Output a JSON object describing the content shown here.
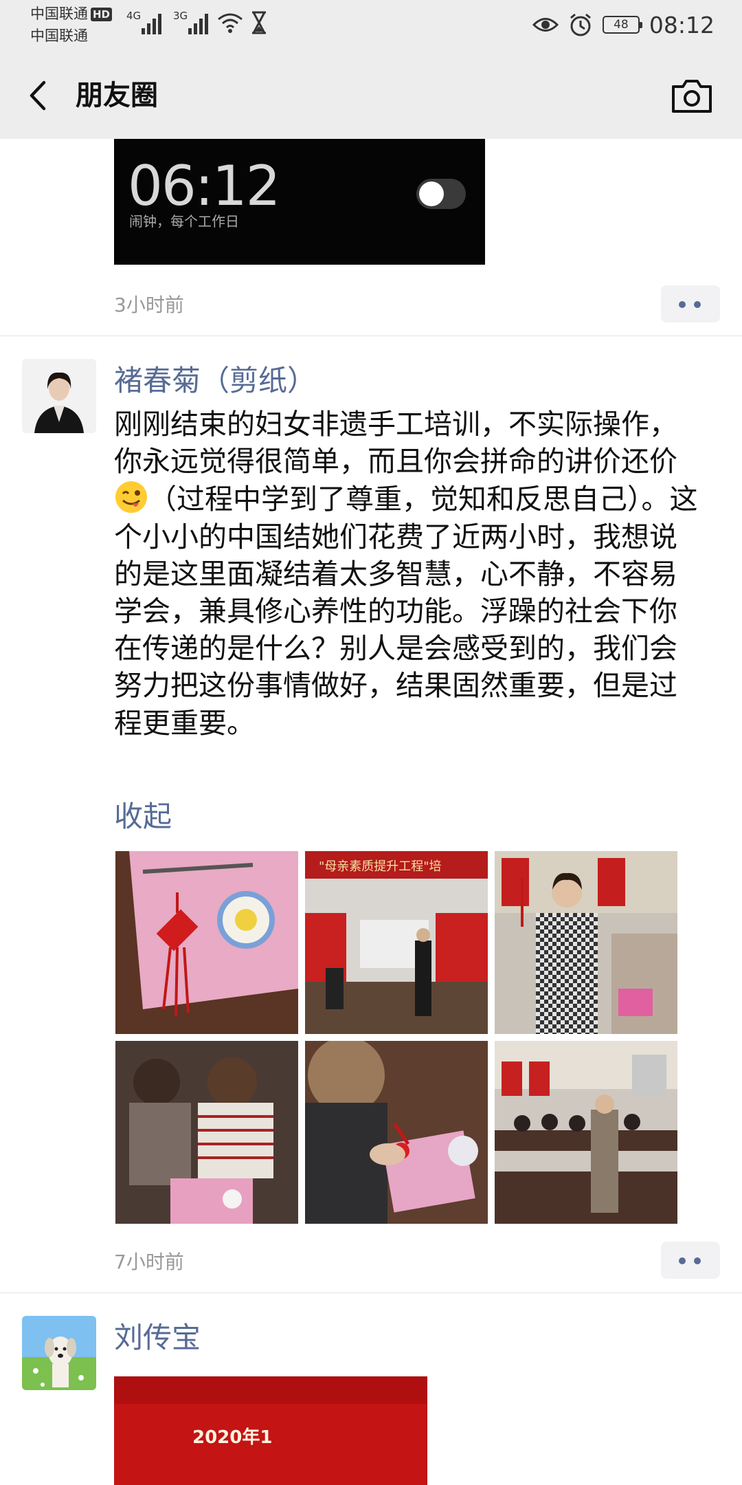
{
  "status_bar": {
    "carrier_1": "中国联通",
    "carrier_1_badge": "HD",
    "carrier_2": "中国联通",
    "signal_1_label": "4G",
    "signal_2_label": "3G",
    "battery": "48",
    "time": "08:12",
    "icons": [
      "eye-icon",
      "alarm-icon",
      "hourglass-icon",
      "wifi-icon"
    ]
  },
  "navbar": {
    "title": "朋友圈",
    "back_icon": "chevron-left-icon",
    "camera_icon": "camera-icon"
  },
  "posts": [
    {
      "image_text_time": "06:12",
      "image_text_sub": "闹钟，每个工作日",
      "timestamp": "3小时前"
    },
    {
      "author": "褚春菊（剪纸）",
      "text_before_emoji": "刚刚结束的妇女非遗手工培训，不实际操作，你永远觉得很简单，而且你会拼命的讲价还价",
      "emoji": "winking-tongue-emoji",
      "text_after_emoji": "（过程中学到了尊重，觉知和反思自己）。这个小小的中国结她们花费了近两小时，我想说的是这里面凝结着太多智慧，心不静，不容易学会，兼具修心养性的功能。浮躁的社会下你在传递的是什么？别人是会感受到的，我们会努力把这份事情做好，结果固然重要，但是过程更重要。",
      "collapse_label": "收起",
      "photo_banner_text": "\"母亲素质提升工程\"培",
      "timestamp": "7小时前"
    },
    {
      "author": "刘传宝",
      "image_text": "2020年1"
    }
  ],
  "colors": {
    "link_blue": "#576b95",
    "nav_background": "#ededed",
    "timestamp_gray": "#999999"
  }
}
